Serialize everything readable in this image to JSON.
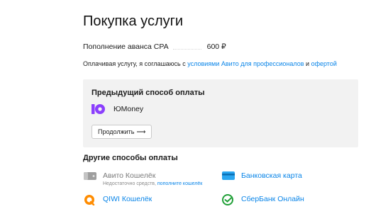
{
  "page": {
    "title": "Покупка услуги"
  },
  "line_item": {
    "label": "Пополнение аванса CPA",
    "amount": "600 ₽"
  },
  "agreement": {
    "prefix": "Оплачивая услугу, я соглашаюсь с ",
    "terms_link": "условиями Авито для профессионалов",
    "joiner": " и ",
    "offer_link": "офертой"
  },
  "previous_method": {
    "title": "Предыдущий способ оплаты",
    "name": "ЮMoney",
    "continue_label": "Продолжить",
    "continue_arrow": "⟶"
  },
  "other_methods": {
    "title": "Другие способы оплаты",
    "items": [
      {
        "name": "Авито Кошелёк",
        "sub_text": "Недостаточно средств, ",
        "sub_link": "пополните кошелёк",
        "icon": "wallet-icon"
      },
      {
        "name": "Банковская карта",
        "icon": "bank-card-icon"
      },
      {
        "name": "QIWI Кошелёк",
        "icon": "qiwi-icon"
      },
      {
        "name": "СберБанк Онлайн",
        "icon": "sberbank-icon"
      }
    ]
  },
  "colors": {
    "link": "#0a85e8",
    "yoomoney": "#8b3ffd",
    "qiwi": "#ff8c00",
    "sber": "#21a038",
    "card_bg": "#f2f2f2"
  }
}
